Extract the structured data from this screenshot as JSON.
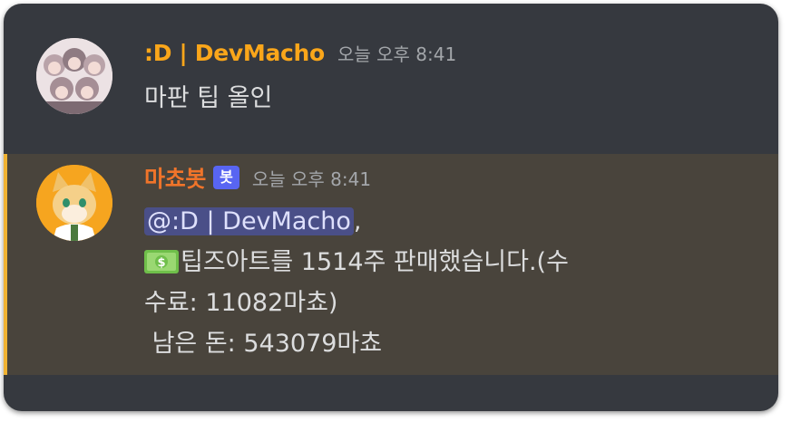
{
  "messages": [
    {
      "username": ":D | DevMacho",
      "username_color": "#faa61a",
      "timestamp": "오늘 오후 8:41",
      "lines": [
        "마판 팁 올인"
      ]
    },
    {
      "username": "마쵸봇",
      "username_color": "#f0742a",
      "bot_tag": "봇",
      "timestamp": "오늘 오후 8:41",
      "mention": "@:D | DevMacho",
      "mention_suffix": ",",
      "line2": "팁즈아트를 1514주 판매했습니다.(수",
      "line3": "수료: 11082마쵸)",
      "line4": " 남은 돈: 543079마쵸",
      "icon": "money-icon",
      "highlight_color": "#f0b232"
    }
  ]
}
